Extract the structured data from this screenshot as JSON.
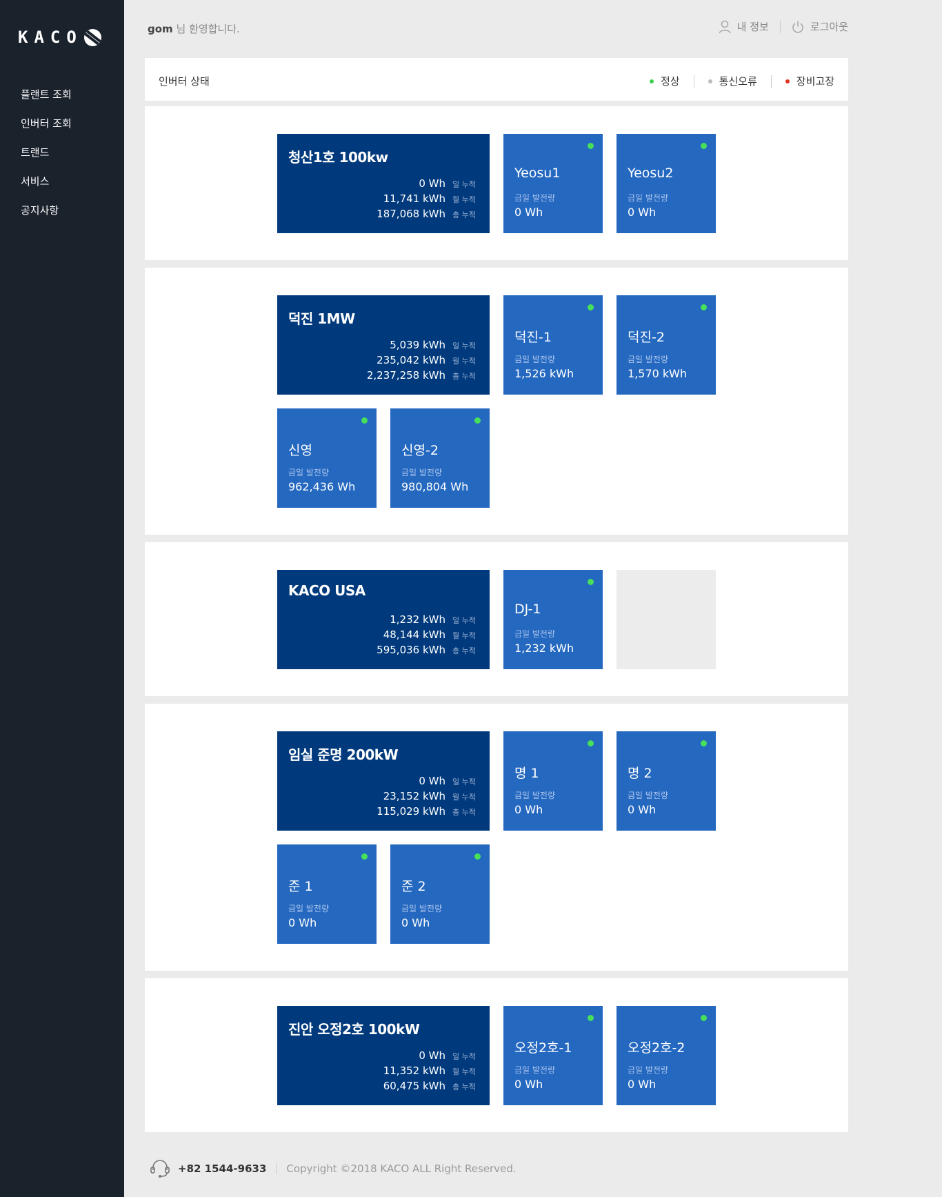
{
  "brand": {
    "name": "KACO"
  },
  "nav": {
    "items": [
      "플랜트 조회",
      "인버터 조회",
      "트랜드",
      "서비스",
      "공지사항"
    ]
  },
  "header": {
    "username": "gom",
    "welcome_suffix": " 님 환영합니다.",
    "my_info": "내 정보",
    "logout": "로그아웃"
  },
  "status_bar": {
    "title": "인버터 상태",
    "legend": [
      {
        "label": "정상",
        "color": "#3ccf4e"
      },
      {
        "label": "통신오류",
        "color": "#bbbbbb"
      },
      {
        "label": "장비고장",
        "color": "#e0301e"
      }
    ]
  },
  "labels": {
    "daily": "일 누적",
    "monthly": "월 누적",
    "total": "총 누적",
    "today_gen": "금일 발전량"
  },
  "plants": [
    {
      "name": "청산1호 100kw",
      "daily": "0 Wh",
      "monthly": "11,741 kWh",
      "total": "187,068 kWh",
      "inverters": [
        {
          "name": "Yeosu1",
          "value": "0 Wh",
          "status": "normal"
        },
        {
          "name": "Yeosu2",
          "value": "0 Wh",
          "status": "normal"
        }
      ]
    },
    {
      "name": "덕진 1MW",
      "daily": "5,039 kWh",
      "monthly": "235,042 kWh",
      "total": "2,237,258 kWh",
      "inverters": [
        {
          "name": "덕진-1",
          "value": "1,526 kWh",
          "status": "normal"
        },
        {
          "name": "덕진-2",
          "value": "1,570 kWh",
          "status": "normal"
        },
        {
          "name": "신영",
          "value": "962,436 Wh",
          "status": "normal"
        },
        {
          "name": "신영-2",
          "value": "980,804 Wh",
          "status": "normal"
        }
      ]
    },
    {
      "name": "KACO USA",
      "daily": "1,232 kWh",
      "monthly": "48,144 kWh",
      "total": "595,036 kWh",
      "inverters": [
        {
          "name": "DJ-1",
          "value": "1,232 kWh",
          "status": "normal"
        }
      ]
    },
    {
      "name": "임실 준명 200kW",
      "daily": "0 Wh",
      "monthly": "23,152 kWh",
      "total": "115,029 kWh",
      "inverters": [
        {
          "name": "명 1",
          "value": "0 Wh",
          "status": "normal"
        },
        {
          "name": "명 2",
          "value": "0 Wh",
          "status": "normal"
        },
        {
          "name": "준 1",
          "value": "0 Wh",
          "status": "normal"
        },
        {
          "name": "준 2",
          "value": "0 Wh",
          "status": "normal"
        }
      ]
    },
    {
      "name": "진안 오정2호 100kW",
      "daily": "0 Wh",
      "monthly": "11,352 kWh",
      "total": "60,475 kWh",
      "inverters": [
        {
          "name": "오정2호-1",
          "value": "0 Wh",
          "status": "normal"
        },
        {
          "name": "오정2호-2",
          "value": "0 Wh",
          "status": "normal"
        }
      ]
    }
  ],
  "footer": {
    "phone": "+82 1544-9633",
    "copyright": "Copyright ©2018 KACO ALL Right Reserved."
  }
}
